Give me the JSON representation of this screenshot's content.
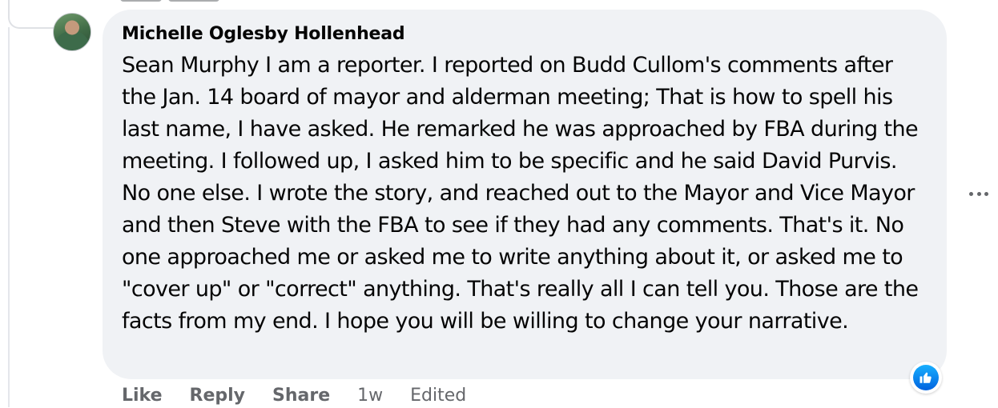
{
  "comment": {
    "author": "Michelle Oglesby Hollenhead",
    "text": "Sean Murphy I am a reporter. I reported on Budd Cullom's comments after the Jan. 14 board of mayor and alderman meeting; That is how to spell his last name, I have asked. He remarked he was approached by FBA during the meeting. I followed up, I asked him to be specific and he said David Purvis. No one else. I wrote the story, and reached out to the Mayor and Vice Mayor and then Steve with the FBA to see if they had any comments. That's it. No one approached me or asked me to write anything about it, or asked me to \"cover up\" or \"correct\" anything. That's really all I can tell you. Those are the facts from my end. I hope you will be willing to change your narrative.",
    "reaction_icon": "like-icon"
  },
  "actions": {
    "like": "Like",
    "reply": "Reply",
    "share": "Share",
    "time": "1w",
    "edited": "Edited"
  },
  "more_icon": "more-options-icon",
  "colors": {
    "bubble_bg": "#f0f2f5",
    "secondary_text": "#65676b",
    "like_blue": "#0866ff"
  }
}
